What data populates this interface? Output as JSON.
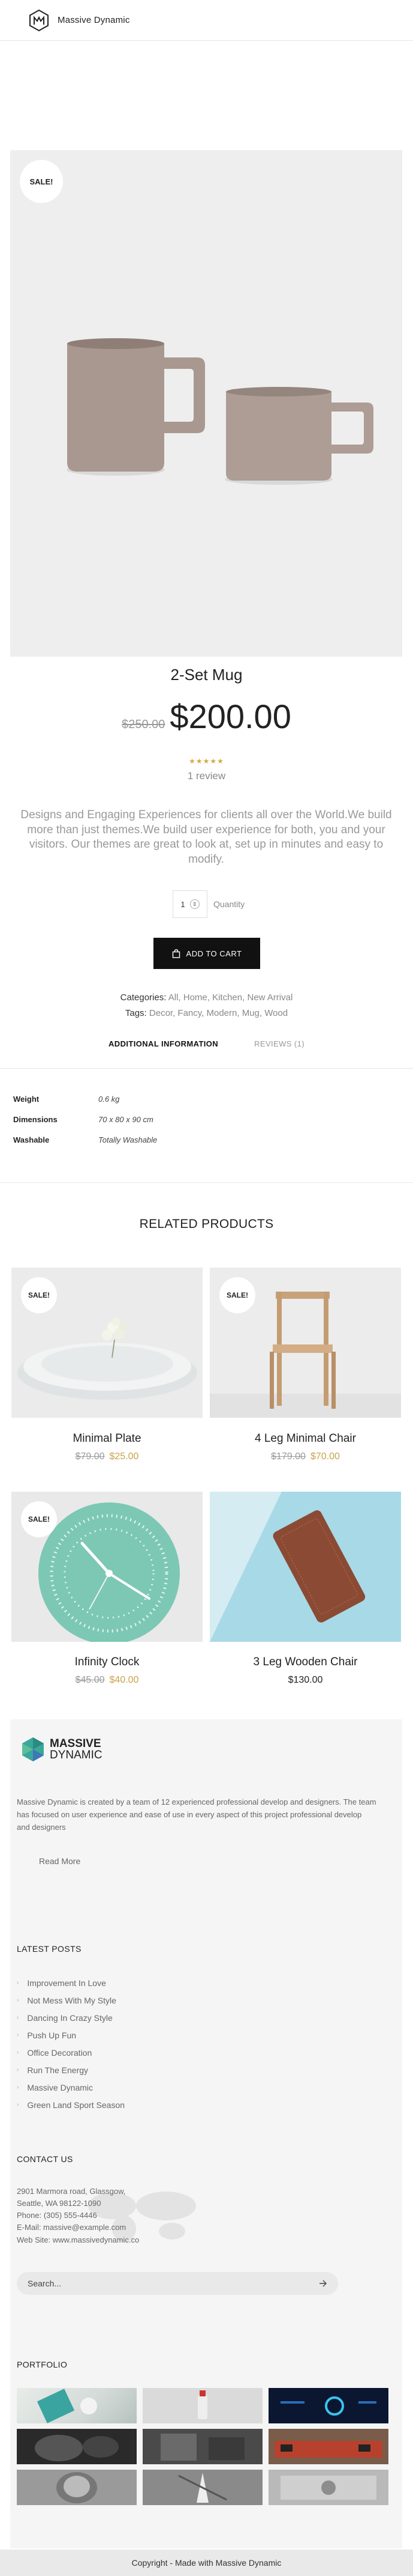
{
  "header": {
    "brand": "Massive Dynamic"
  },
  "product": {
    "badge": "SALE!",
    "title": "2-Set Mug",
    "old_price": "$250.00",
    "new_price": "$200.00",
    "rating": {
      "stars": 5,
      "text": "1 review"
    },
    "description": "Designs and Engaging Experiences for clients all over the World.We build more than just themes.We build user experience for both, you and your visitors. Our themes are great to look at, set up in minutes and easy to modify.",
    "quantity": "1",
    "quantity_label": "Quantity",
    "add_to_cart": "ADD TO CART",
    "categories_label": "Categories:",
    "categories": "All, Home, Kitchen, New Arrival",
    "tags_label": "Tags:",
    "tags": "Decor, Fancy, Modern, Mug, Wood"
  },
  "tabs": {
    "additional": "ADDITIONAL INFORMATION",
    "reviews": "REVIEWS (1)"
  },
  "specs": [
    {
      "key": "Weight",
      "value": "0.6 kg"
    },
    {
      "key": "Dimensions",
      "value": "70 x 80 x 90 cm"
    },
    {
      "key": "Washable",
      "value": "Totally Washable"
    }
  ],
  "related": {
    "title": "RELATED PRODUCTS",
    "items": [
      {
        "name": "Minimal Plate",
        "old": "$79.00",
        "price": "$25.00",
        "badge": "SALE!"
      },
      {
        "name": "4 Leg Minimal Chair",
        "old": "$179.00",
        "price": "$70.00",
        "badge": "SALE!"
      },
      {
        "name": "Infinity Clock",
        "old": "$45.00",
        "price": "$40.00",
        "badge": "SALE!"
      },
      {
        "name": "3 Leg Wooden Chair",
        "old": "",
        "price": "$130.00",
        "badge": ""
      }
    ]
  },
  "footer": {
    "logo_top": "MASSIVE",
    "logo_bottom": "DYNAMIC",
    "about": "Massive Dynamic is created by a team of 12 experienced professional develop and designers. The team has focused on user experience and ease of use in every aspect of this project professional develop and designers",
    "read_more": "Read More",
    "latest_posts_title": "LATEST POSTS",
    "posts": [
      "Improvement In Love",
      "Not Mess With My Style",
      "Dancing In Crazy Style",
      "Push Up Fun",
      "Office Decoration",
      "Run The Energy",
      "Massive Dynamic",
      "Green Land Sport Season"
    ],
    "contact_title": "CONTACT US",
    "contact": [
      "2901 Marmora road, Glassgow,",
      "Seattle, WA 98122-1090",
      "Phone: (305) 555-4446",
      "E-Mail: massive@example.com",
      "Web Site: www.massivedynamic.co"
    ],
    "search_placeholder": "Search...",
    "portfolio_title": "PORTFOLIO"
  },
  "copyright": "Copyright - Made with Massive Dynamic"
}
